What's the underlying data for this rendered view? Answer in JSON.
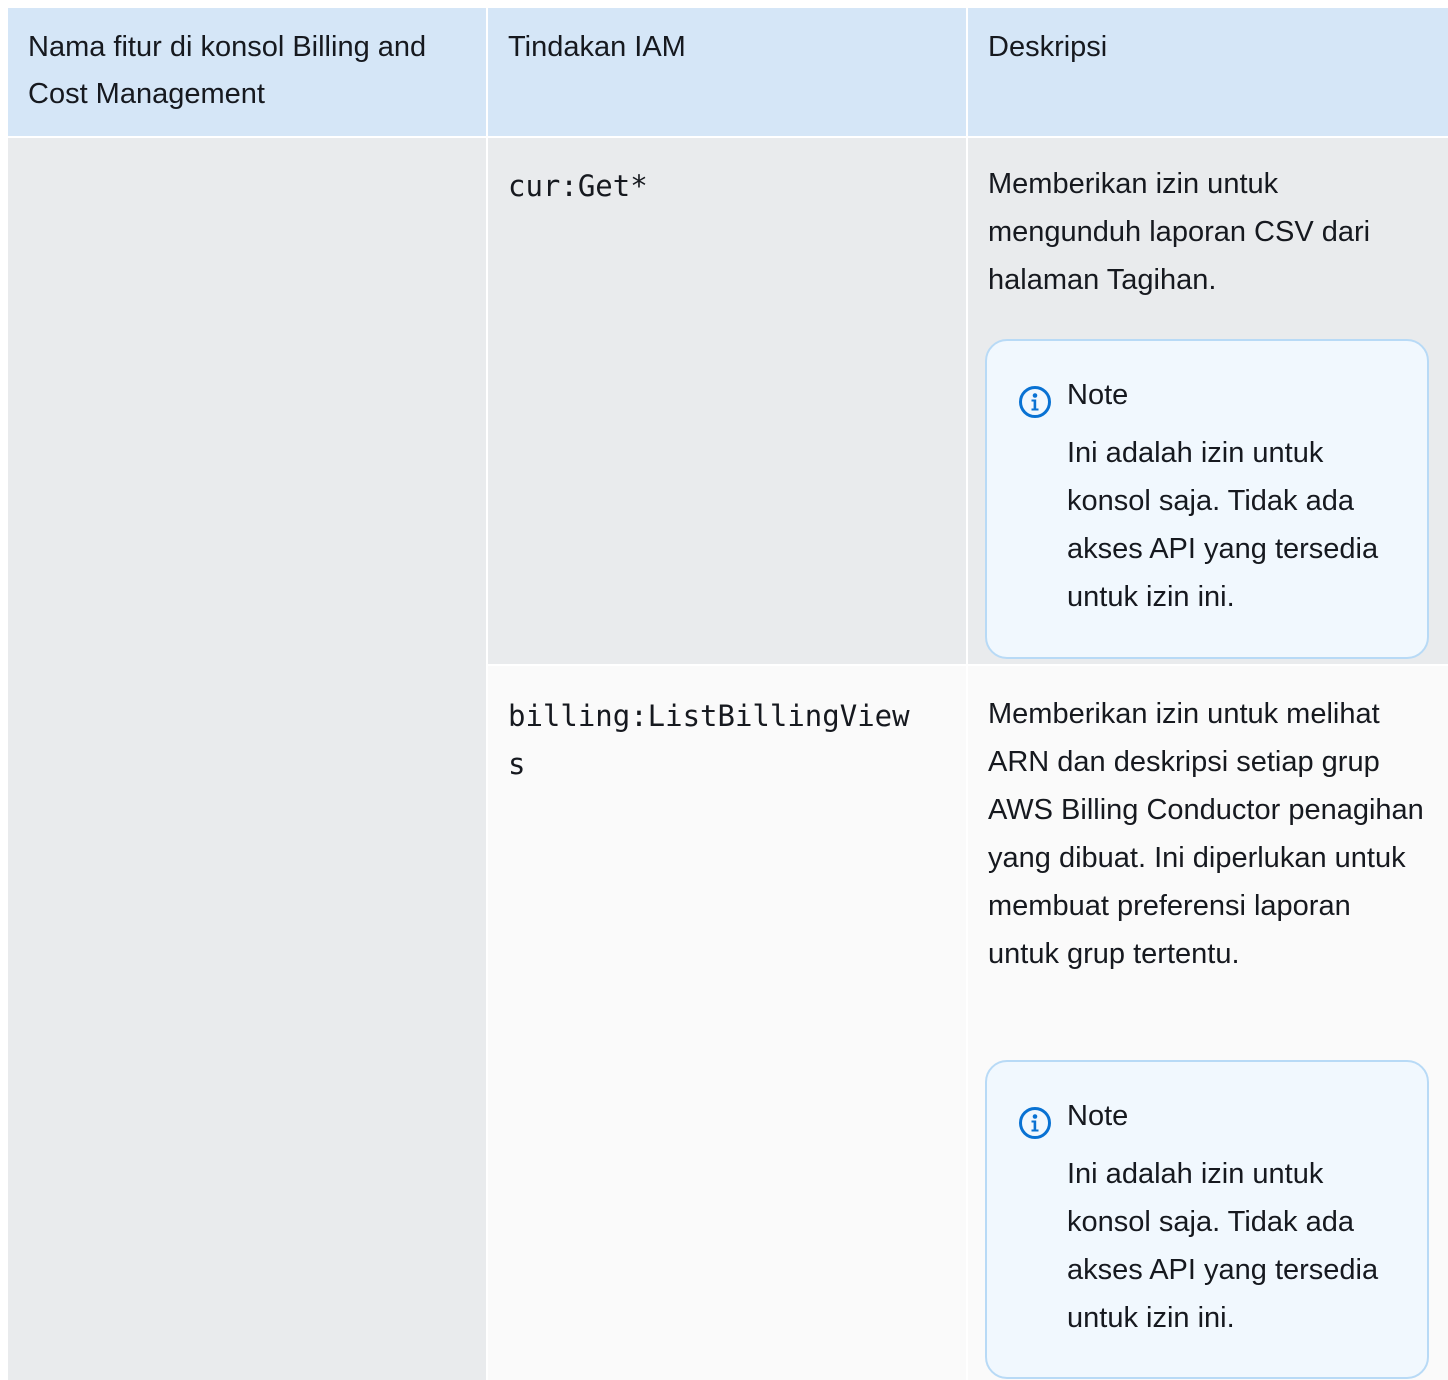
{
  "table": {
    "headers": [
      "Nama fitur di konsol Billing and Cost Management",
      "Tindakan IAM",
      "Deskripsi"
    ],
    "rows": [
      {
        "feature": "",
        "action": "cur:Get*",
        "description": "Memberikan izin untuk mengunduh laporan CSV dari halaman Tagihan.",
        "note_title": "Note",
        "note_body": "Ini adalah izin untuk konsol saja. Tidak ada akses API yang tersedia untuk izin ini."
      },
      {
        "feature": "",
        "action": "billing:ListBillingViews",
        "description": "Memberikan izin untuk melihat ARN dan deskripsi setiap grup AWS Billing Conductor penagihan yang dibuat. Ini diperlukan untuk membuat preferensi laporan untuk grup tertentu.",
        "note_title": "Note",
        "note_body": "Ini adalah izin untuk konsol saja. Tidak ada akses API yang tersedia untuk izin ini."
      }
    ]
  },
  "colors": {
    "header_bg": "#d5e6f7",
    "shaded_row_bg": "#e9ebed",
    "plain_row_bg": "#fafafa",
    "note_bg": "#f1f8fe",
    "note_border": "#b8daf6",
    "info_icon": "#0972d3"
  },
  "icons": {
    "note": "info-circle-icon"
  }
}
